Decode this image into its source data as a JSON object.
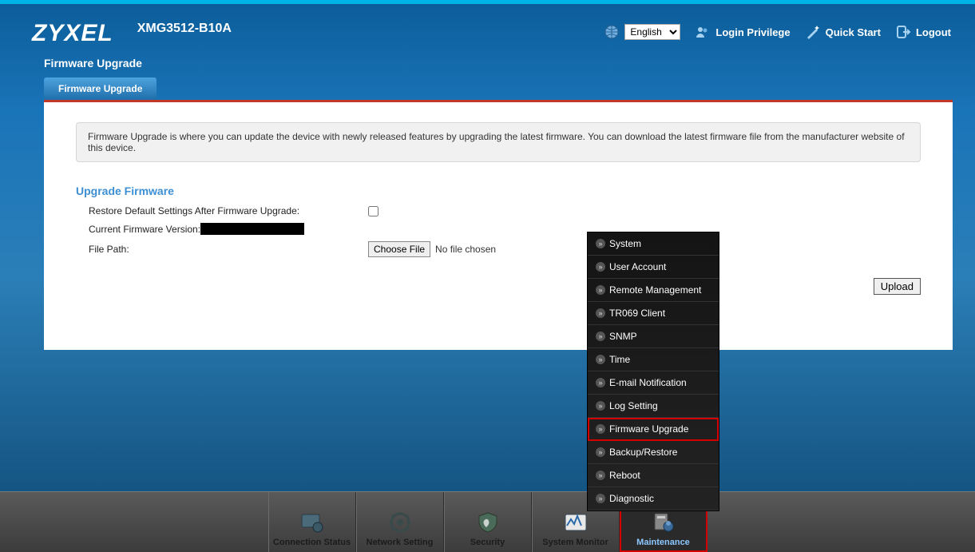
{
  "brand": "ZYXEL",
  "model": "XMG3512-B10A",
  "top": {
    "language_value": "English",
    "login_privilege": "Login Privilege",
    "quick_start": "Quick Start",
    "logout": "Logout"
  },
  "page_title": "Firmware Upgrade",
  "tab_label": "Firmware Upgrade",
  "info_text": "Firmware Upgrade is where you can update the device with newly released features by upgrading the latest firmware. You can download the latest firmware file from the manufacturer website of this device.",
  "section_title": "Upgrade Firmware",
  "form": {
    "restore_label": "Restore Default Settings After Firmware Upgrade:",
    "version_label": "Current Firmware Version:",
    "file_path_label": "File Path:",
    "choose_button": "Choose File",
    "no_file": "No file chosen",
    "upload_button": "Upload"
  },
  "flyout_items": [
    {
      "label": "System",
      "highlight": false
    },
    {
      "label": "User Account",
      "highlight": false
    },
    {
      "label": "Remote Management",
      "highlight": false
    },
    {
      "label": "TR069 Client",
      "highlight": false
    },
    {
      "label": "SNMP",
      "highlight": false
    },
    {
      "label": "Time",
      "highlight": false
    },
    {
      "label": "E-mail Notification",
      "highlight": false
    },
    {
      "label": "Log Setting",
      "highlight": false
    },
    {
      "label": "Firmware Upgrade",
      "highlight": true
    },
    {
      "label": "Backup/Restore",
      "highlight": false
    },
    {
      "label": "Reboot",
      "highlight": false
    },
    {
      "label": "Diagnostic",
      "highlight": false
    }
  ],
  "nav": [
    {
      "label": "Connection Status",
      "active": false,
      "highlight": false
    },
    {
      "label": "Network Setting",
      "active": false,
      "highlight": false
    },
    {
      "label": "Security",
      "active": false,
      "highlight": false
    },
    {
      "label": "System Monitor",
      "active": false,
      "highlight": false
    },
    {
      "label": "Maintenance",
      "active": true,
      "highlight": true
    }
  ]
}
